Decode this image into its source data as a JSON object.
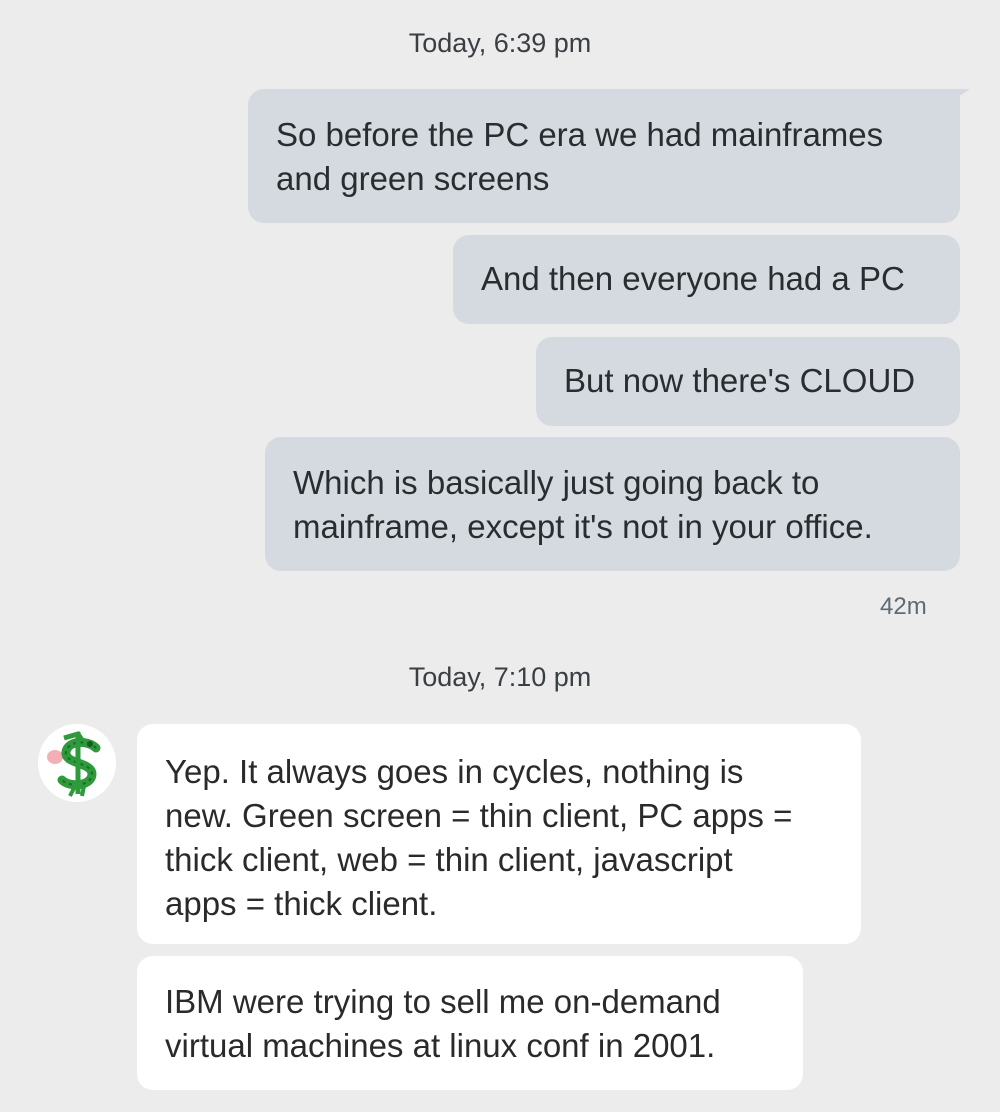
{
  "conversation": {
    "groups": [
      {
        "timestamp": "Today, 6:39 pm",
        "messages": [
          {
            "text": "So before the PC era we had mainframes\nand green screens"
          },
          {
            "text": "And then everyone had a PC"
          },
          {
            "text": "But now there's CLOUD"
          },
          {
            "text": "Which is basically just going back to\nmainframe, except it's not in your office."
          }
        ],
        "relative_time": "42m"
      },
      {
        "timestamp": "Today, 7:10 pm",
        "sender_avatar_icon": "dollar-sign-creature-icon",
        "messages": [
          {
            "text": "Yep. It always goes in cycles, nothing is\nnew. Green screen = thin client, PC apps =\nthick client, web = thin client, javascript\napps = thick client."
          },
          {
            "text": "IBM were trying to sell me on-demand\nvirtual machines at linux conf in 2001."
          }
        ]
      }
    ]
  },
  "colors": {
    "background": "#ececec",
    "outgoing_bubble": "#d4dadf",
    "incoming_bubble": "#ffffff",
    "avatar_green": "#2e9a3c"
  }
}
